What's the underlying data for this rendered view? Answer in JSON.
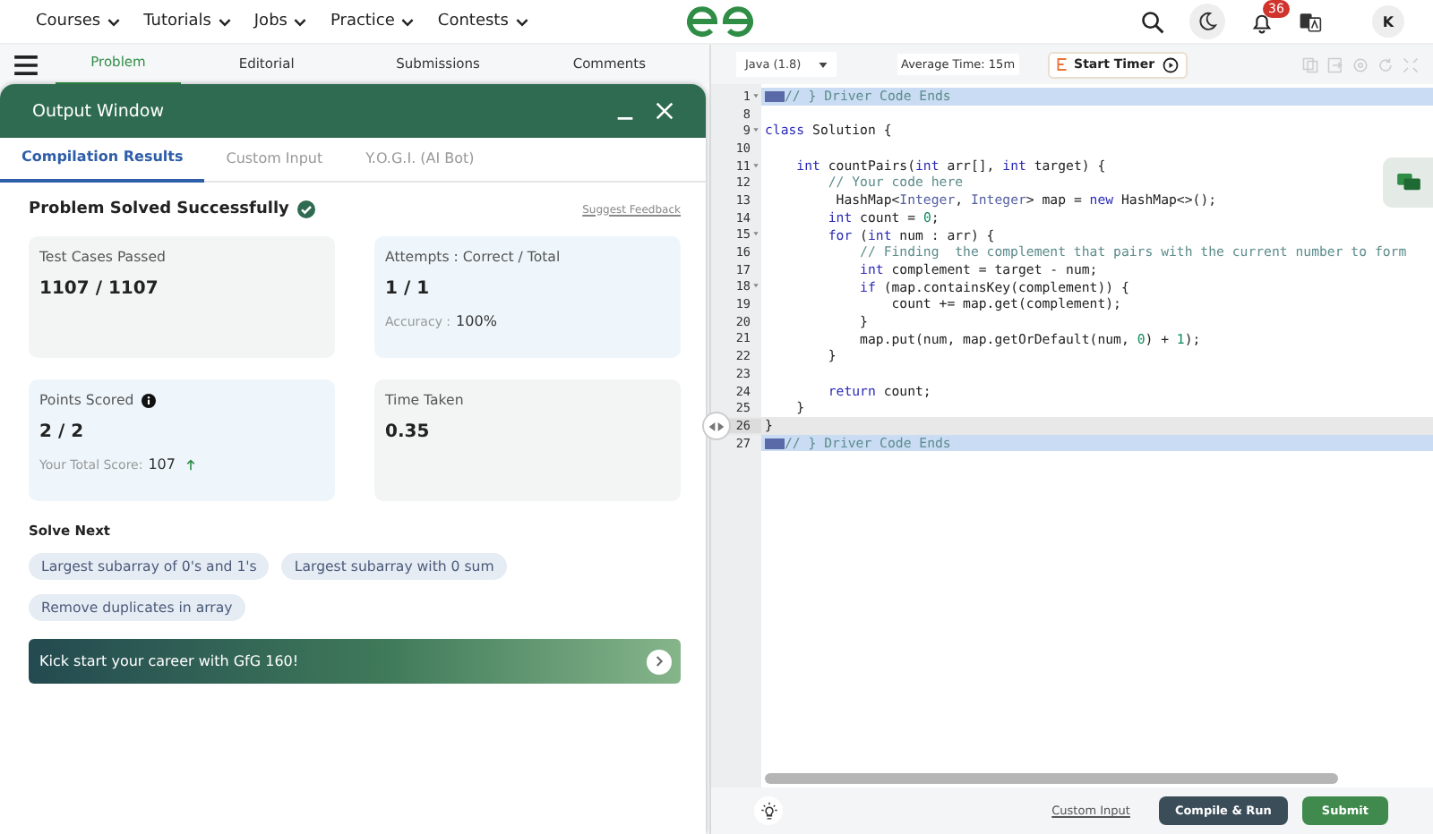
{
  "nav": {
    "items": [
      "Courses",
      "Tutorials",
      "Jobs",
      "Practice",
      "Contests"
    ],
    "notifications": "36",
    "avatar": "K"
  },
  "problem_tabs": [
    {
      "label": "Problem",
      "selected": true
    },
    {
      "label": "Editorial",
      "selected": false
    },
    {
      "label": "Submissions",
      "selected": false
    },
    {
      "label": "Comments",
      "selected": false
    }
  ],
  "output_window": {
    "title": "Output Window",
    "tabs": [
      {
        "label": "Compilation Results",
        "selected": true
      },
      {
        "label": "Custom Input",
        "selected": false
      },
      {
        "label": "Y.O.G.I. (AI Bot)",
        "selected": false
      }
    ],
    "status": "Problem Solved Successfully",
    "feedback_link": "Suggest Feedback",
    "cards": [
      {
        "label": "Test Cases Passed",
        "value": "1107 / 1107",
        "info": false,
        "color": "#f2f5f4"
      },
      {
        "label": "Attempts : Correct / Total",
        "value": "1 / 1",
        "note_label": "Accuracy :",
        "note_value": "100%",
        "info": false,
        "color": "#eef6fb"
      },
      {
        "label": "Points Scored",
        "value": "2 / 2",
        "note_label": "Your Total Score:",
        "note_value": "107",
        "trend_up": true,
        "info": true,
        "color": "#eef6fb"
      },
      {
        "label": "Time Taken",
        "value": "0.35",
        "info": false,
        "color": "#f2f5f4"
      }
    ],
    "solve_next": {
      "heading": "Solve Next",
      "items": [
        "Largest subarray of 0's and 1's",
        "Largest subarray with 0 sum",
        "Remove duplicates in array"
      ]
    },
    "banner": "Kick start your career with GfG 160!"
  },
  "editor": {
    "language": "Java (1.8)",
    "average_time": "Average Time: 15m",
    "timer_button": "Start Timer",
    "lines": [
      {
        "number": "1",
        "foldable": true,
        "selected": true,
        "current": false,
        "marker": true,
        "tokens": [
          {
            "kind": "comment",
            "text": "// } Driver Code Ends"
          }
        ]
      },
      {
        "number": "8",
        "foldable": false,
        "selected": false,
        "current": false
      },
      {
        "number": "9",
        "foldable": true,
        "selected": false,
        "current": false,
        "tokens": [
          {
            "kind": "kw",
            "text": "class"
          },
          {
            "kind": "plain",
            "text": " Solution {"
          }
        ]
      },
      {
        "number": "10",
        "foldable": false,
        "selected": false,
        "current": false
      },
      {
        "number": "11",
        "foldable": true,
        "selected": false,
        "current": false,
        "tokens": [
          {
            "kind": "kw",
            "text": "    int"
          },
          {
            "kind": "plain",
            "text": " countPairs("
          },
          {
            "kind": "kw",
            "text": "int"
          },
          {
            "kind": "plain",
            "text": " arr[], "
          },
          {
            "kind": "kw",
            "text": "int"
          },
          {
            "kind": "plain",
            "text": " target) {"
          }
        ]
      },
      {
        "number": "12",
        "foldable": false,
        "selected": false,
        "current": false,
        "tokens": [
          {
            "kind": "comment",
            "text": "        // Your code here"
          }
        ]
      },
      {
        "number": "13",
        "foldable": false,
        "selected": false,
        "current": false,
        "tokens": [
          {
            "kind": "plain",
            "text": "         HashMap<"
          },
          {
            "kind": "type",
            "text": "Integer"
          },
          {
            "kind": "plain",
            "text": ", "
          },
          {
            "kind": "type",
            "text": "Integer"
          },
          {
            "kind": "plain",
            "text": "> map = "
          },
          {
            "kind": "kw",
            "text": "new"
          },
          {
            "kind": "plain",
            "text": " HashMap<>();"
          }
        ]
      },
      {
        "number": "14",
        "foldable": false,
        "selected": false,
        "current": false,
        "tokens": [
          {
            "kind": "kw",
            "text": "        int"
          },
          {
            "kind": "plain",
            "text": " count = "
          },
          {
            "kind": "num",
            "text": "0"
          },
          {
            "kind": "plain",
            "text": ";"
          }
        ]
      },
      {
        "number": "15",
        "foldable": true,
        "selected": false,
        "current": false,
        "tokens": [
          {
            "kind": "kw",
            "text": "        for"
          },
          {
            "kind": "plain",
            "text": " ("
          },
          {
            "kind": "kw",
            "text": "int"
          },
          {
            "kind": "plain",
            "text": " num : arr) {"
          }
        ]
      },
      {
        "number": "16",
        "foldable": false,
        "selected": false,
        "current": false,
        "tokens": [
          {
            "kind": "comment",
            "text": "            // Finding  the complement that pairs with the current number to form"
          }
        ]
      },
      {
        "number": "17",
        "foldable": false,
        "selected": false,
        "current": false,
        "tokens": [
          {
            "kind": "kw",
            "text": "            int"
          },
          {
            "kind": "plain",
            "text": " complement = target - num;"
          }
        ]
      },
      {
        "number": "18",
        "foldable": true,
        "selected": false,
        "current": false,
        "tokens": [
          {
            "kind": "kw",
            "text": "            if"
          },
          {
            "kind": "plain",
            "text": " (map.containsKey(complement)) {"
          }
        ]
      },
      {
        "number": "19",
        "foldable": false,
        "selected": false,
        "current": false,
        "tokens": [
          {
            "kind": "plain",
            "text": "                count += map.get(complement);"
          }
        ]
      },
      {
        "number": "20",
        "foldable": false,
        "selected": false,
        "current": false,
        "tokens": [
          {
            "kind": "plain",
            "text": "            }"
          }
        ]
      },
      {
        "number": "21",
        "foldable": false,
        "selected": false,
        "current": false,
        "tokens": [
          {
            "kind": "plain",
            "text": "            map.put(num, map.getOrDefault(num, "
          },
          {
            "kind": "num",
            "text": "0"
          },
          {
            "kind": "plain",
            "text": ") + "
          },
          {
            "kind": "num",
            "text": "1"
          },
          {
            "kind": "plain",
            "text": ");"
          }
        ]
      },
      {
        "number": "22",
        "foldable": false,
        "selected": false,
        "current": false,
        "tokens": [
          {
            "kind": "plain",
            "text": "        }"
          }
        ]
      },
      {
        "number": "23",
        "foldable": false,
        "selected": false,
        "current": false
      },
      {
        "number": "24",
        "foldable": false,
        "selected": false,
        "current": false,
        "tokens": [
          {
            "kind": "kw",
            "text": "        return"
          },
          {
            "kind": "plain",
            "text": " count;"
          }
        ]
      },
      {
        "number": "25",
        "foldable": false,
        "selected": false,
        "current": false,
        "tokens": [
          {
            "kind": "plain",
            "text": "    }"
          }
        ]
      },
      {
        "number": "26",
        "foldable": false,
        "selected": false,
        "current": true,
        "tokens": [
          {
            "kind": "plain",
            "text": "}"
          }
        ]
      },
      {
        "number": "27",
        "foldable": false,
        "selected": true,
        "current": false,
        "marker": true,
        "tokens": [
          {
            "kind": "comment",
            "text": "// } Driver Code Ends"
          }
        ]
      }
    ]
  },
  "footer": {
    "custom_input": "Custom Input",
    "compile": "Compile & Run",
    "submit": "Submit"
  }
}
